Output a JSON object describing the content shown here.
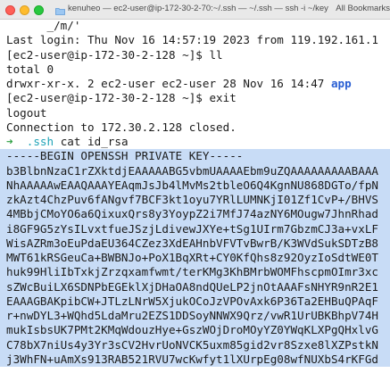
{
  "window": {
    "title": "kenuheo — ec2-user@ip-172-30-2-70:~/.ssh — ~/.ssh — ssh -i ~/keys/jpjenkins.pem",
    "bookmarks_label": "All Bookmarks"
  },
  "terminal": {
    "lines": [
      {
        "kind": "plain",
        "text": "      _/m/'"
      },
      {
        "kind": "plain",
        "text": "Last login: Thu Nov 16 14:57:19 2023 from 119.192.161.1"
      },
      {
        "kind": "plain",
        "text": "[ec2-user@ip-172-30-2-128 ~]$ ll"
      },
      {
        "kind": "plain",
        "text": "total 0"
      },
      {
        "kind": "ls",
        "text": "drwxr-xr-x. 2 ec2-user ec2-user 28 Nov 16 14:47 ",
        "dir": "app"
      },
      {
        "kind": "plain",
        "text": "[ec2-user@ip-172-30-2-128 ~]$ exit"
      },
      {
        "kind": "plain",
        "text": "logout"
      },
      {
        "kind": "plain",
        "text": "Connection to 172.30.2.128 closed."
      },
      {
        "kind": "prompt",
        "arrow": "➜",
        "dir": ".ssh",
        "command": "cat id_rsa"
      },
      {
        "kind": "sel",
        "text": "-----BEGIN OPENSSH PRIVATE KEY-----"
      },
      {
        "kind": "sel",
        "text": "b3BlbnNzaC1rZXktdjEAAAAABG5vbmUAAAAEbm9uZQAAAAAAAAABAAA"
      },
      {
        "kind": "sel",
        "text": "NhAAAAAwEAAQAAAYEAqmJsJb4lMvMs2tbleO6Q4KgnNU868DGTo/fpN"
      },
      {
        "kind": "sel",
        "text": "zkAzt4ChzPuv6fANgvf7BCF3kt1oyu7YRlLUMNKjI01Zf1CvP+/BHVS"
      },
      {
        "kind": "sel",
        "text": "4MBbjCMoYO6a6QixuxQrs8y3YoypZ2i7MfJ74azNY6MOugw7JhnRhad"
      },
      {
        "kind": "sel",
        "text": "i8GF9G5zYsILvxtfueJSzjLdivewJXYe+tSg1UIrm7GbzmCJ3a+vxLF"
      },
      {
        "kind": "sel",
        "text": "WisAZRm3oEuPdaEU364CZez3XdEAHnbVFVTvBwrB/K3WVdSukSDTzB8"
      },
      {
        "kind": "sel",
        "text": "MWT61kRSGeuCa+BWBNJo+PoX1BqXRt+CY0KfQhs8z92OyzIoSdtWE0T"
      },
      {
        "kind": "sel",
        "text": "huk99HliIbTxkjZrzqxamfwmt/terKMg3KhBMrbWOMFhscpmOImr3xc"
      },
      {
        "kind": "sel",
        "text": "sZWcBuiLX6SDNPbEGEklXjDHaOA8ndQUeLP2jnOtAAAFsNHYR9nR2E1"
      },
      {
        "kind": "sel",
        "text": "EAAAGBAKpibCW+JTLzLNrW5XjukOCoJzVPOvAxk6P36Ta2EHBuQPAqF"
      },
      {
        "kind": "sel",
        "text": "r+nwDYL3+WQhd5LdaMru2EZS1DDSoyNNWX9Qrz/vwR1UrUBKBhpV74H"
      },
      {
        "kind": "sel",
        "text": "mukIsbsUK7PMt2KMqWdouzHye+GszWOjDroMOyYZ0YWqKLXPgQHxlvG"
      },
      {
        "kind": "sel",
        "text": "C78bX7niUs4y3Yr3sCV2HvrUoNVCK5uxm85gid2vr8Szxe8lXZPstkN"
      },
      {
        "kind": "sel",
        "text": "j3WhFN+uAmXs913RAB521RVU7wcKwfyt1lXUrpEg08wfNUXbS4rKFGd"
      }
    ]
  }
}
